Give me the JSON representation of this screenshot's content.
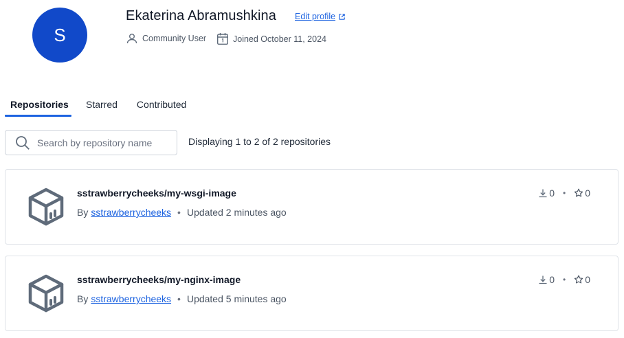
{
  "profile": {
    "avatar_initial": "S",
    "avatar_color": "#1149c9",
    "name": "Ekaterina Abramushkina",
    "edit_label": "Edit profile",
    "role": "Community User",
    "joined": "Joined October 11, 2024"
  },
  "tabs": [
    {
      "label": "Repositories",
      "active": true
    },
    {
      "label": "Starred",
      "active": false
    },
    {
      "label": "Contributed",
      "active": false
    }
  ],
  "search": {
    "placeholder": "Search by repository name",
    "value": ""
  },
  "results_text": "Displaying 1 to 2 of 2 repositories",
  "repositories": [
    {
      "name": "sstrawberrycheeks/my-wsgi-image",
      "by_prefix": "By",
      "owner": "sstrawberrycheeks",
      "updated": "Updated 2 minutes ago",
      "downloads": "0",
      "stars": "0"
    },
    {
      "name": "sstrawberrycheeks/my-nginx-image",
      "by_prefix": "By",
      "owner": "sstrawberrycheeks",
      "updated": "Updated 5 minutes ago",
      "downloads": "0",
      "stars": "0"
    }
  ],
  "colors": {
    "accent": "#1d63e0",
    "icon_gray": "#5f6b7a"
  },
  "icons": [
    "external-link-icon",
    "user-icon",
    "calendar-icon",
    "search-icon",
    "repository-box-icon",
    "download-icon",
    "star-icon"
  ]
}
